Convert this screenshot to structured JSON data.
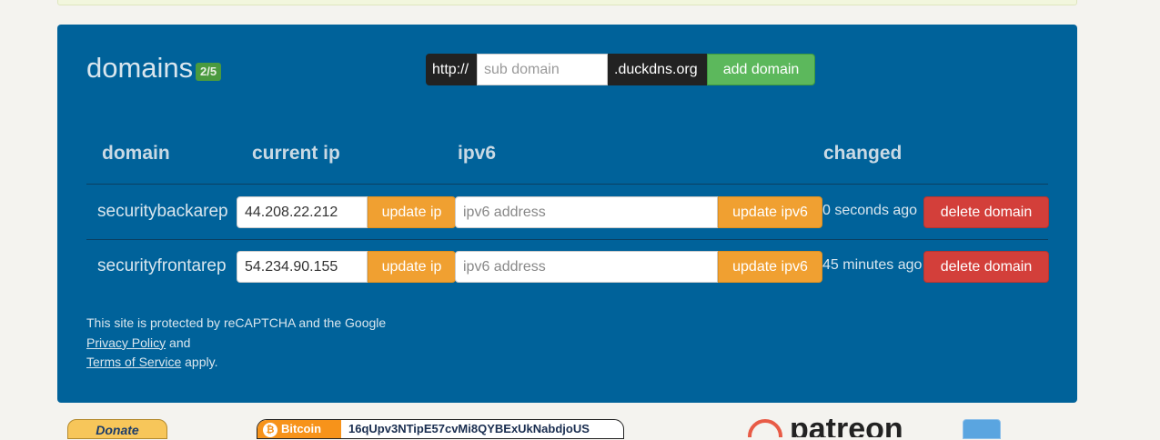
{
  "header": {
    "title": "domains",
    "count_badge": "2/5"
  },
  "add_form": {
    "prefix": "http://",
    "placeholder": "sub domain",
    "suffix": ".duckdns.org",
    "button": "add domain"
  },
  "table": {
    "columns": [
      "domain",
      "current ip",
      "ipv6",
      "changed"
    ],
    "rows": [
      {
        "domain": "securitybackarep",
        "ip": "44.208.22.212",
        "update_ip": "update ip",
        "ipv6_placeholder": "ipv6 address",
        "update_ipv6": "update ipv6",
        "changed": "0 seconds ago",
        "delete": "delete domain"
      },
      {
        "domain": "securityfrontarep",
        "ip": "54.234.90.155",
        "update_ip": "update ip",
        "ipv6_placeholder": "ipv6 address",
        "update_ipv6": "update ipv6",
        "changed": "45 minutes ago",
        "delete": "delete domain"
      }
    ]
  },
  "footer": {
    "line1": "This site is protected by reCAPTCHA and the Google",
    "privacy_link": "Privacy Policy",
    "and_text": " and",
    "terms_link": "Terms of Service",
    "apply_text": " apply."
  },
  "bottom": {
    "donate": "Donate",
    "bitcoin_label": "Bitcoin",
    "bitcoin_address": "16qUpv3NTipE57cvMi8QYBExUkNabdjoUS",
    "patreon": "patreon"
  },
  "colors": {
    "panel": "#00629a",
    "add_button": "#5cb85c",
    "update_button": "#f0a031",
    "delete_button": "#d33f3a",
    "badge": "#4a9a3f"
  }
}
